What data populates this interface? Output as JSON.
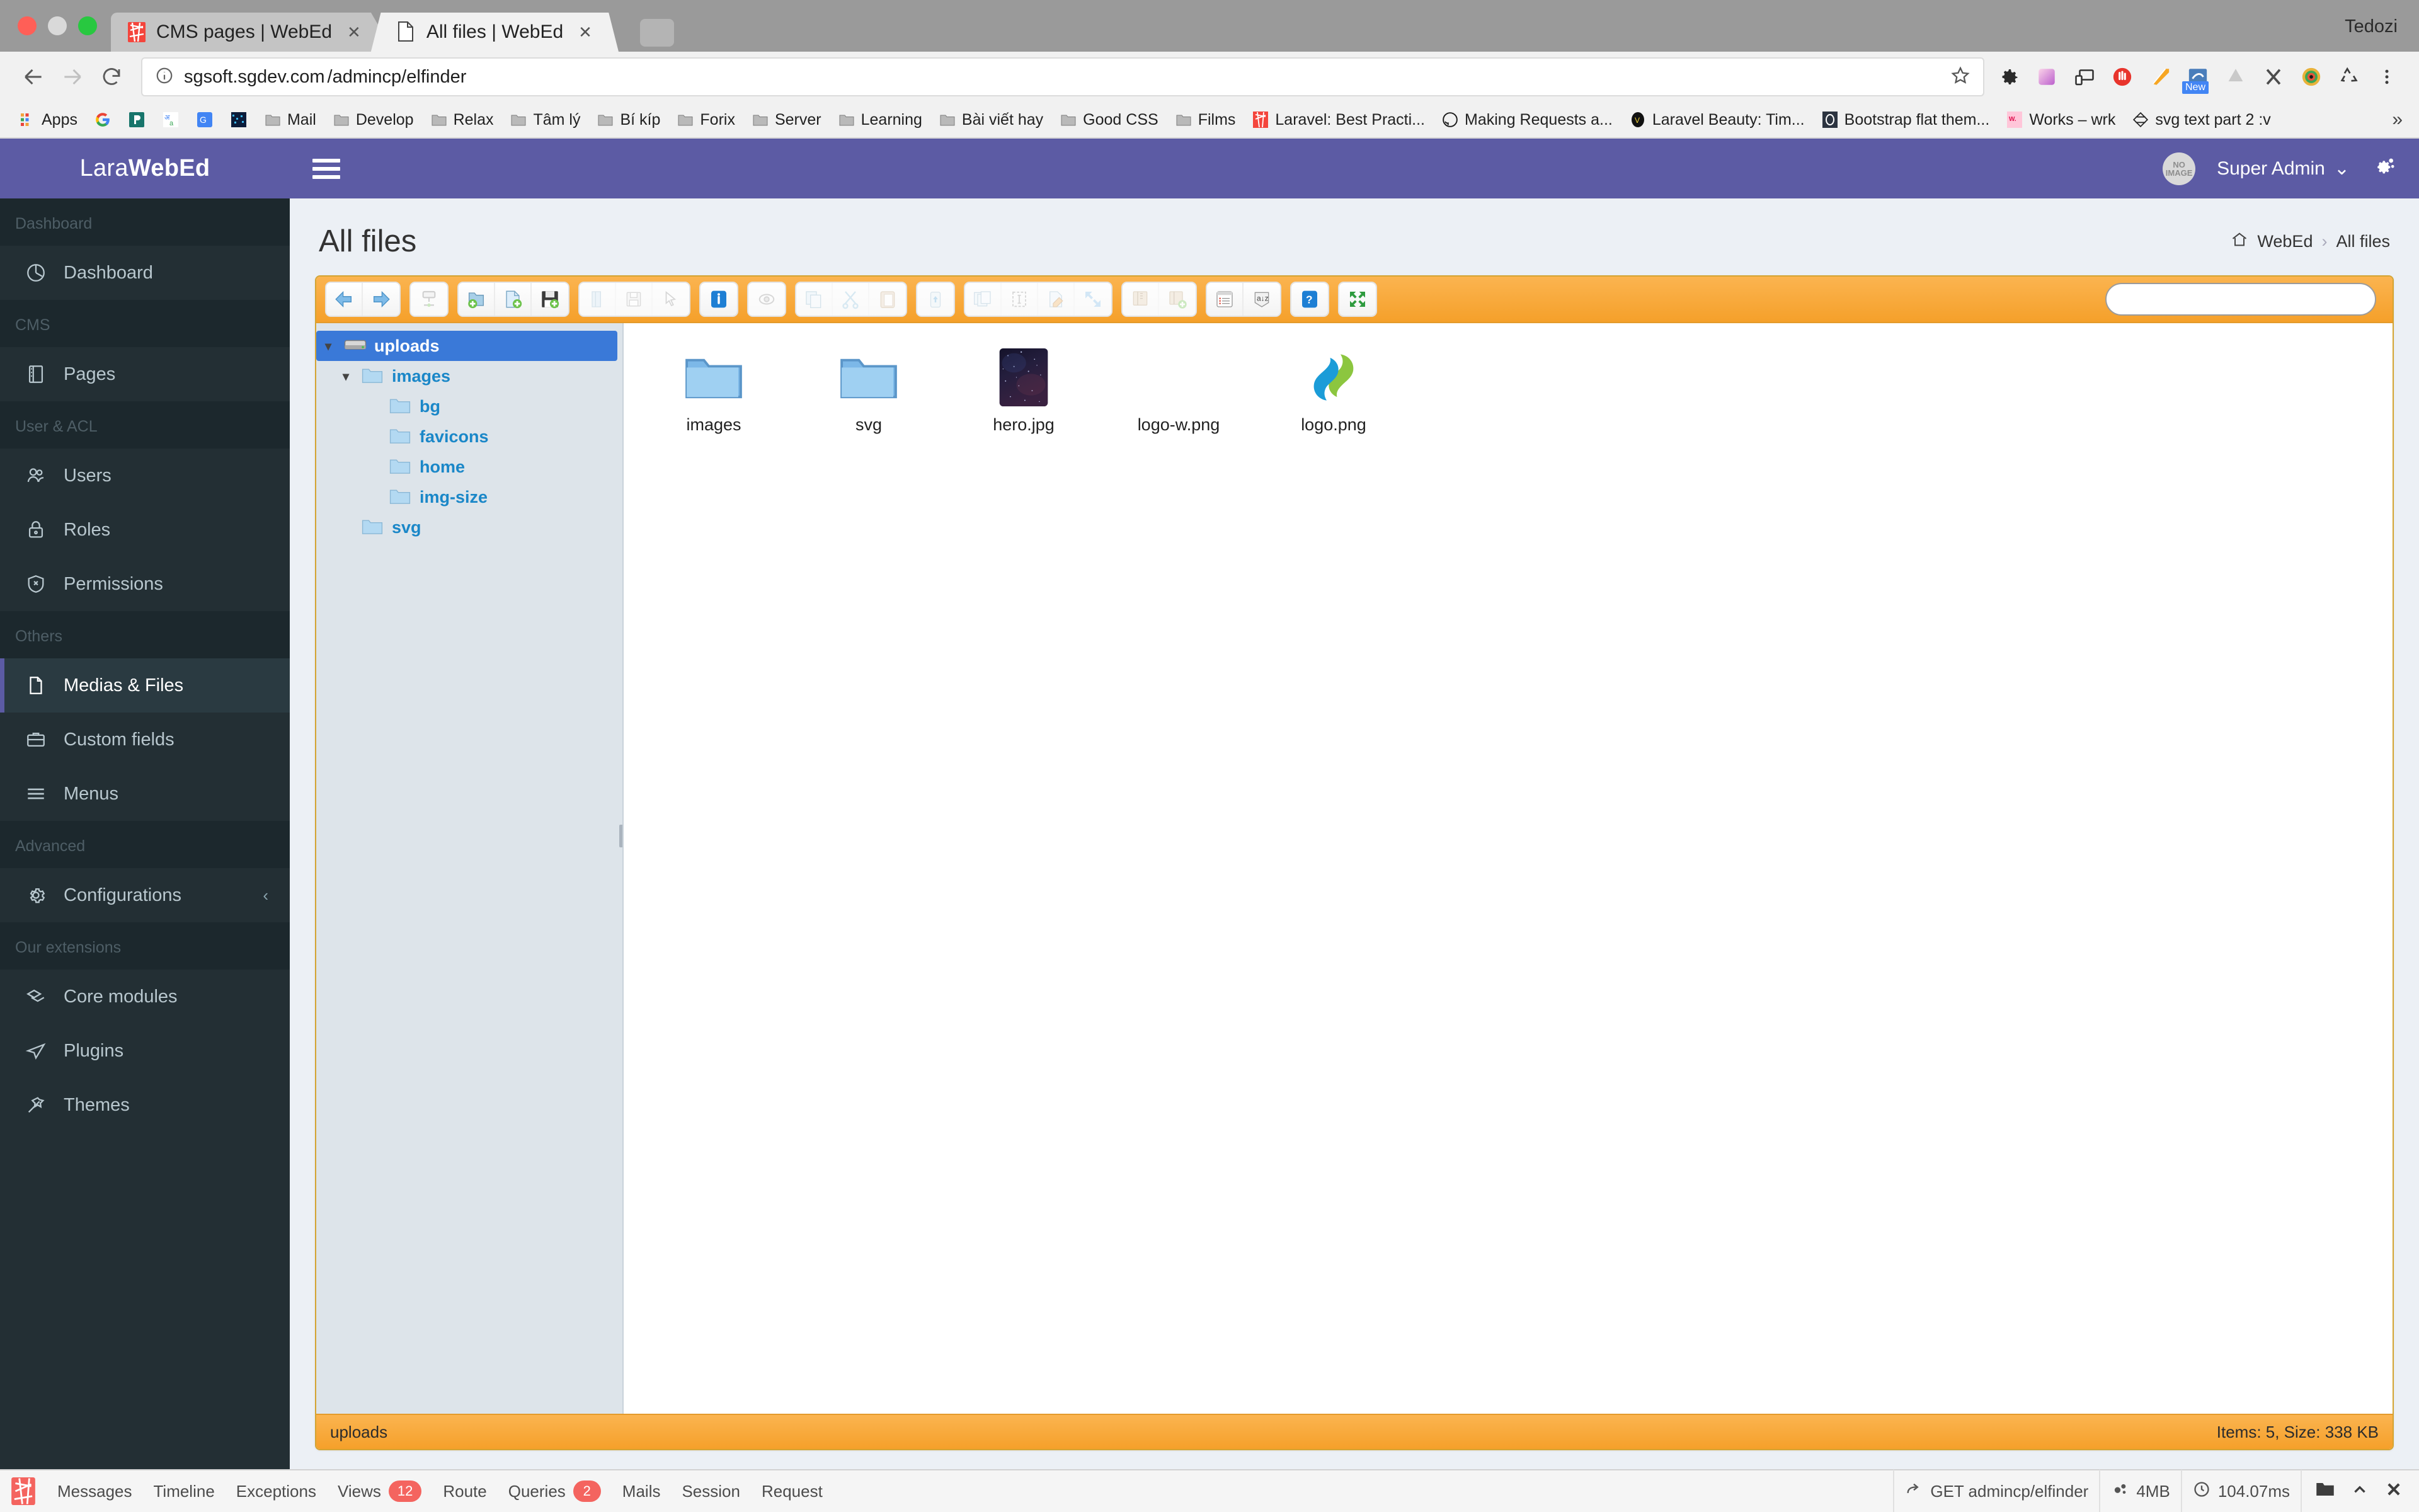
{
  "browser": {
    "window_user": "Tedozi",
    "tabs": [
      {
        "title": "CMS pages | WebEd",
        "favicon": "laravel-icon",
        "active": false
      },
      {
        "title": "All files | WebEd",
        "favicon": "document-icon",
        "active": true
      }
    ],
    "url": {
      "host": "sgsoft.sgdev.com",
      "path": "/admincp/elfinder"
    },
    "nav": {
      "back": "back-icon",
      "forward": "forward-icon",
      "reload": "reload-icon"
    },
    "bookmarks": [
      {
        "label": "Apps",
        "icon": "apps-grid-icon"
      },
      {
        "label": "",
        "icon": "google-icon"
      },
      {
        "label": "",
        "icon": "bitbucket-icon"
      },
      {
        "label": "",
        "icon": "translate-icon"
      },
      {
        "label": "",
        "icon": "gsuite-icon"
      },
      {
        "label": "",
        "icon": "pixel-icon"
      },
      {
        "label": "Mail",
        "icon": "folder-icon"
      },
      {
        "label": "Develop",
        "icon": "folder-icon"
      },
      {
        "label": "Relax",
        "icon": "folder-icon"
      },
      {
        "label": "Tâm lý",
        "icon": "folder-icon"
      },
      {
        "label": "Bí kíp",
        "icon": "folder-icon"
      },
      {
        "label": "Forix",
        "icon": "folder-icon"
      },
      {
        "label": "Server",
        "icon": "folder-icon"
      },
      {
        "label": "Learning",
        "icon": "folder-icon"
      },
      {
        "label": "Bài viết hay",
        "icon": "folder-icon"
      },
      {
        "label": "Good CSS",
        "icon": "folder-icon"
      },
      {
        "label": "Films",
        "icon": "folder-icon"
      },
      {
        "label": "Laravel: Best Practi...",
        "icon": "laravel-icon"
      },
      {
        "label": "Making Requests a...",
        "icon": "github-icon"
      },
      {
        "label": "Laravel Beauty: Tim...",
        "icon": "v-circle-icon"
      },
      {
        "label": "Bootstrap flat them...",
        "icon": "bootstrap-icon"
      },
      {
        "label": "Works – wrk",
        "icon": "w-pink-icon"
      },
      {
        "label": "svg text part 2 :v",
        "icon": "svg-diamond-icon"
      }
    ],
    "bookmark_overflow": "»",
    "extensions": [
      "gear-icon",
      "palette-icon",
      "responsive-icon",
      "adblock-icon",
      "ruler-icon",
      "snapshot-new-icon",
      "drive-icon",
      "x-icon",
      "colorpicker-icon",
      "recycle-icon",
      "menu-dots-icon"
    ]
  },
  "app": {
    "brand": {
      "light": "Lara",
      "bold": "WebEd"
    },
    "sidebar": {
      "groups": [
        {
          "header": "Dashboard",
          "items": [
            {
              "label": "Dashboard",
              "icon": "pie-chart-icon",
              "active": false
            }
          ]
        },
        {
          "header": "CMS",
          "items": [
            {
              "label": "Pages",
              "icon": "book-icon",
              "active": false
            }
          ]
        },
        {
          "header": "User & ACL",
          "items": [
            {
              "label": "Users",
              "icon": "users-icon",
              "active": false
            },
            {
              "label": "Roles",
              "icon": "lock-icon",
              "active": false
            },
            {
              "label": "Permissions",
              "icon": "shield-x-icon",
              "active": false
            }
          ]
        },
        {
          "header": "Others",
          "items": [
            {
              "label": "Medias & Files",
              "icon": "file-icon",
              "active": true
            },
            {
              "label": "Custom fields",
              "icon": "briefcase-icon",
              "active": false
            },
            {
              "label": "Menus",
              "icon": "menu-lines-icon",
              "active": false
            }
          ]
        },
        {
          "header": "Advanced",
          "items": [
            {
              "label": "Configurations",
              "icon": "gear-icon",
              "active": false,
              "chevron": "‹"
            }
          ]
        },
        {
          "header": "Our extensions",
          "items": [
            {
              "label": "Core modules",
              "icon": "cube-icon",
              "active": false
            },
            {
              "label": "Plugins",
              "icon": "paper-plane-icon",
              "active": false
            },
            {
              "label": "Themes",
              "icon": "magic-wand-icon",
              "active": false
            }
          ]
        }
      ]
    },
    "topbar": {
      "hamburger": "hamburger-icon",
      "user_name": "Super Admin",
      "user_caret": "⌄",
      "avatar_line1": "NO",
      "avatar_line2": "IMAGE",
      "settings_icon": "gears-icon"
    },
    "page_title": "All files",
    "breadcrumb": {
      "home_icon": "home-icon",
      "root": "WebEd",
      "sep": "›",
      "current": "All files"
    }
  },
  "elfinder": {
    "toolbar_groups": [
      {
        "buttons": [
          {
            "name": "back-button",
            "icon": "arrow-left-blue",
            "disabled": false
          },
          {
            "name": "forward-button",
            "icon": "arrow-right-blue",
            "disabled": false
          }
        ]
      },
      {
        "buttons": [
          {
            "name": "netmount-button",
            "icon": "netmount",
            "disabled": true
          }
        ]
      },
      {
        "buttons": [
          {
            "name": "new-folder-button",
            "icon": "folder-add",
            "disabled": false
          },
          {
            "name": "new-file-button",
            "icon": "file-add",
            "disabled": false
          },
          {
            "name": "upload-button",
            "icon": "upload-disk",
            "disabled": false
          }
        ]
      },
      {
        "buttons": [
          {
            "name": "open-button",
            "icon": "open-folder",
            "disabled": true
          },
          {
            "name": "download-button",
            "icon": "floppy",
            "disabled": true
          },
          {
            "name": "getfile-button",
            "icon": "cursor",
            "disabled": true
          }
        ]
      },
      {
        "buttons": [
          {
            "name": "info-button",
            "icon": "info-blue",
            "disabled": false
          }
        ]
      },
      {
        "buttons": [
          {
            "name": "quicklook-button",
            "icon": "eye",
            "disabled": true
          }
        ]
      },
      {
        "buttons": [
          {
            "name": "copy-button",
            "icon": "copy",
            "disabled": true
          },
          {
            "name": "cut-button",
            "icon": "scissors",
            "disabled": true
          },
          {
            "name": "paste-button",
            "icon": "clipboard",
            "disabled": true
          }
        ]
      },
      {
        "buttons": [
          {
            "name": "trash-button",
            "icon": "trash",
            "disabled": true
          }
        ]
      },
      {
        "buttons": [
          {
            "name": "duplicate-button",
            "icon": "duplicate",
            "disabled": true
          },
          {
            "name": "rename-button",
            "icon": "rename",
            "disabled": true
          },
          {
            "name": "edit-button",
            "icon": "edit-pencil",
            "disabled": true
          },
          {
            "name": "resize-button",
            "icon": "resize-arrows",
            "disabled": true
          }
        ]
      },
      {
        "buttons": [
          {
            "name": "archive-button",
            "icon": "archive",
            "disabled": true
          },
          {
            "name": "extract-button",
            "icon": "extract",
            "disabled": true
          }
        ]
      },
      {
        "buttons": [
          {
            "name": "view-button",
            "icon": "list-view",
            "disabled": false
          },
          {
            "name": "sort-button",
            "icon": "sort-az",
            "disabled": false
          }
        ]
      },
      {
        "buttons": [
          {
            "name": "help-button",
            "icon": "help-blue",
            "disabled": false
          }
        ]
      },
      {
        "buttons": [
          {
            "name": "fullscreen-button",
            "icon": "fullscreen-green",
            "disabled": false
          }
        ]
      }
    ],
    "search_placeholder": "",
    "search_value": "",
    "tree": [
      {
        "label": "uploads",
        "level": 0,
        "icon": "volume-disk-icon",
        "arrow": "▾",
        "selected": true
      },
      {
        "label": "images",
        "level": 1,
        "icon": "folder-icon",
        "arrow": "▾",
        "selected": false
      },
      {
        "label": "bg",
        "level": 2,
        "icon": "folder-icon",
        "arrow": "",
        "selected": false
      },
      {
        "label": "favicons",
        "level": 2,
        "icon": "folder-icon",
        "arrow": "",
        "selected": false
      },
      {
        "label": "home",
        "level": 2,
        "icon": "folder-icon",
        "arrow": "",
        "selected": false
      },
      {
        "label": "img-size",
        "level": 2,
        "icon": "folder-icon",
        "arrow": "",
        "selected": false
      },
      {
        "label": "svg",
        "level": 1,
        "icon": "folder-icon",
        "arrow": "",
        "selected": false
      }
    ],
    "files": [
      {
        "name": "images",
        "kind": "folder"
      },
      {
        "name": "svg",
        "kind": "folder"
      },
      {
        "name": "hero.jpg",
        "kind": "image-dark-sky"
      },
      {
        "name": "logo-w.png",
        "kind": "image-blank"
      },
      {
        "name": "logo.png",
        "kind": "image-logo-s"
      }
    ],
    "statusbar": {
      "path": "uploads",
      "summary": "Items: 5, Size: 338 KB"
    }
  },
  "debugbar": {
    "logo": "laravel-logo-icon",
    "items": [
      {
        "label": "Messages",
        "badge": ""
      },
      {
        "label": "Timeline",
        "badge": ""
      },
      {
        "label": "Exceptions",
        "badge": ""
      },
      {
        "label": "Views",
        "badge": "12"
      },
      {
        "label": "Route",
        "badge": ""
      },
      {
        "label": "Queries",
        "badge": "2"
      },
      {
        "label": "Mails",
        "badge": ""
      },
      {
        "label": "Session",
        "badge": ""
      },
      {
        "label": "Request",
        "badge": ""
      }
    ],
    "right": [
      {
        "icon": "share-arrow-icon",
        "label": "GET admincp/elfinder"
      },
      {
        "icon": "gears-icon",
        "label": "4MB"
      },
      {
        "icon": "clock-icon",
        "label": "104.07ms"
      }
    ],
    "controls": [
      "open-folder-icon",
      "chevron-up-icon",
      "close-x-icon"
    ]
  },
  "colors": {
    "brand_purple": "#5c5ba4",
    "sidebar_dark": "#232f34",
    "elfinder_orange": "#f5a02a",
    "tree_selected_blue": "#3a79d8",
    "link_blue": "#1a87c8",
    "debug_red": "#f4645f"
  }
}
